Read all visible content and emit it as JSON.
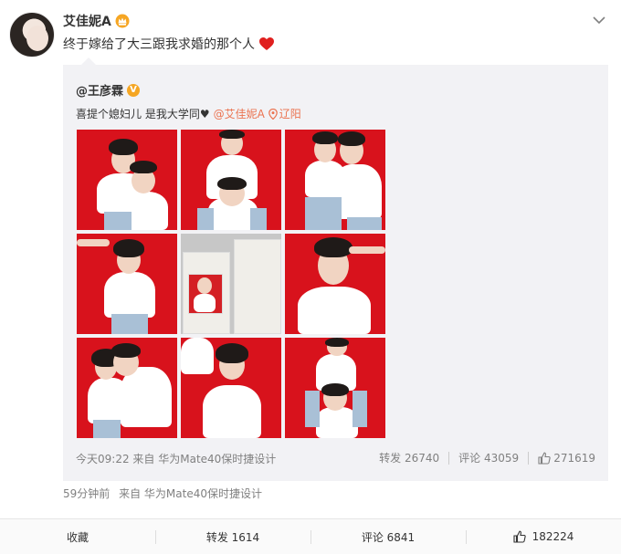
{
  "post": {
    "author": "艾佳妮A",
    "author_badge_icon": "crown-icon",
    "text": "终于嫁给了大三跟我求婚的那个人",
    "text_emoji": "heart-icon",
    "time": "59分钟前",
    "source": "来自 华为Mate40保时捷设计"
  },
  "quote": {
    "author": "@王彦霖",
    "verified_badge": "V",
    "text": "喜提个媳妇儿 是我大学同♥",
    "mention": "@艾佳妮A",
    "location": "辽阳",
    "time": "今天09:22",
    "source": "来自 华为Mate40保时捷设计",
    "repost_label": "转发",
    "repost_count": "26740",
    "comment_label": "评论",
    "comment_count": "43059",
    "like_count": "271619",
    "photos": [
      "couple-photo-1",
      "groom-photo-2",
      "couple-photo-3",
      "bride-photo-4",
      "certificate-photo-5",
      "groom-photo-6",
      "couple-photo-7",
      "bride-photo-8",
      "couple-photo-9"
    ]
  },
  "actions": {
    "favorite": "收藏",
    "repost": "转发 1614",
    "comment": "评论 6841",
    "like": "182224"
  },
  "colors": {
    "accent": "#eb7350",
    "photo_bg": "#d8121c",
    "quote_bg": "#f2f2f5"
  }
}
